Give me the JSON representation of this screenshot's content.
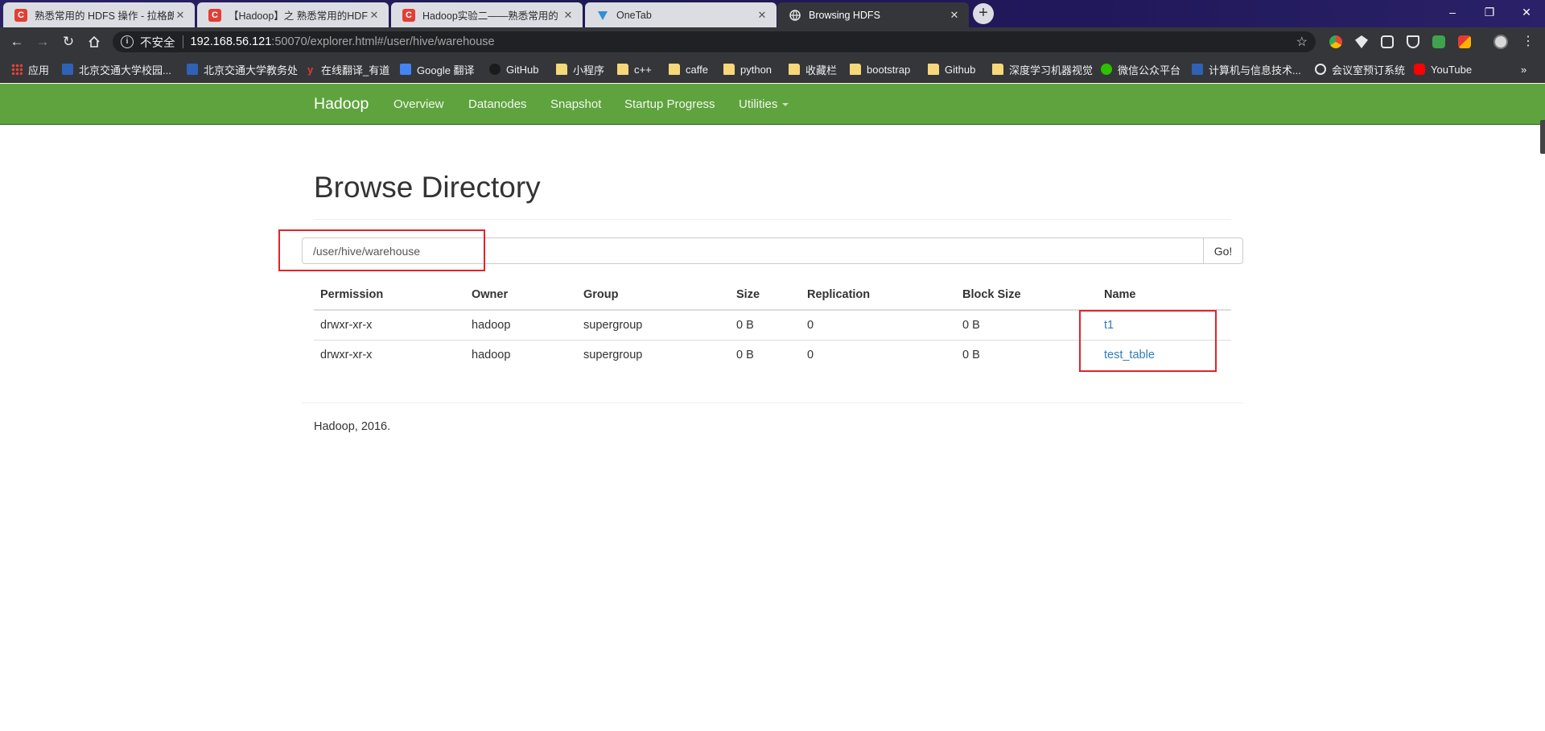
{
  "browser": {
    "tabs": [
      {
        "title": "熟悉常用的 HDFS 操作 - 拉格朗",
        "icon": "csdn-icon"
      },
      {
        "title": "【Hadoop】之 熟悉常用的HDFS",
        "icon": "csdn-icon"
      },
      {
        "title": "Hadoop实验二——熟悉常用的",
        "icon": "csdn-icon"
      },
      {
        "title": "OneTab",
        "icon": "onetab-icon"
      },
      {
        "title": "Browsing HDFS",
        "icon": "globe-icon"
      }
    ],
    "close_glyph": "✕",
    "address": {
      "security_label": "不安全",
      "host": "192.168.56.121",
      "rest": ":50070/explorer.html#/user/hive/warehouse"
    },
    "bookmarks": [
      {
        "label": "应用",
        "icon": "apps-grid-icon"
      },
      {
        "label": "北京交通大学校园...",
        "icon": "bjtu-icon"
      },
      {
        "label": "北京交通大学教务处",
        "icon": "bjtu-icon"
      },
      {
        "label": "在线翻译_有道",
        "icon": "youdao-icon"
      },
      {
        "label": "Google 翻译",
        "icon": "google-translate-icon"
      },
      {
        "label": "GitHub",
        "icon": "github-icon"
      },
      {
        "label": "小程序",
        "icon": "folder-icon"
      },
      {
        "label": "c++",
        "icon": "folder-icon"
      },
      {
        "label": "caffe",
        "icon": "folder-icon"
      },
      {
        "label": "python",
        "icon": "folder-icon"
      },
      {
        "label": "收藏栏",
        "icon": "folder-icon"
      },
      {
        "label": "bootstrap",
        "icon": "folder-icon"
      },
      {
        "label": "Github",
        "icon": "folder-icon"
      },
      {
        "label": "深度学习机器视觉",
        "icon": "folder-icon"
      },
      {
        "label": "微信公众平台",
        "icon": "wechat-icon"
      },
      {
        "label": "计算机与信息技术...",
        "icon": "bjtu-icon"
      },
      {
        "label": "会议室预订系统",
        "icon": "globe-icon"
      },
      {
        "label": "YouTube",
        "icon": "youtube-icon"
      }
    ],
    "overflow_glyph": "»"
  },
  "navbar": {
    "brand": "Hadoop",
    "items": [
      "Overview",
      "Datanodes",
      "Snapshot",
      "Startup Progress",
      "Utilities"
    ]
  },
  "main": {
    "title": "Browse Directory",
    "path_value": "/user/hive/warehouse",
    "go_label": "Go!",
    "table": {
      "columns": [
        "Permission",
        "Owner",
        "Group",
        "Size",
        "Replication",
        "Block Size",
        "Name"
      ],
      "rows": [
        [
          "drwxr-xr-x",
          "hadoop",
          "supergroup",
          "0 B",
          "0",
          "0 B",
          "t1"
        ],
        [
          "drwxr-xr-x",
          "hadoop",
          "supergroup",
          "0 B",
          "0",
          "0 B",
          "test_table"
        ]
      ]
    }
  },
  "footer": {
    "text": "Hadoop, 2016."
  },
  "colors": {
    "navbar_green": "#5fa33e",
    "link_blue": "#337ab7",
    "highlight_red": "#e3232a"
  }
}
